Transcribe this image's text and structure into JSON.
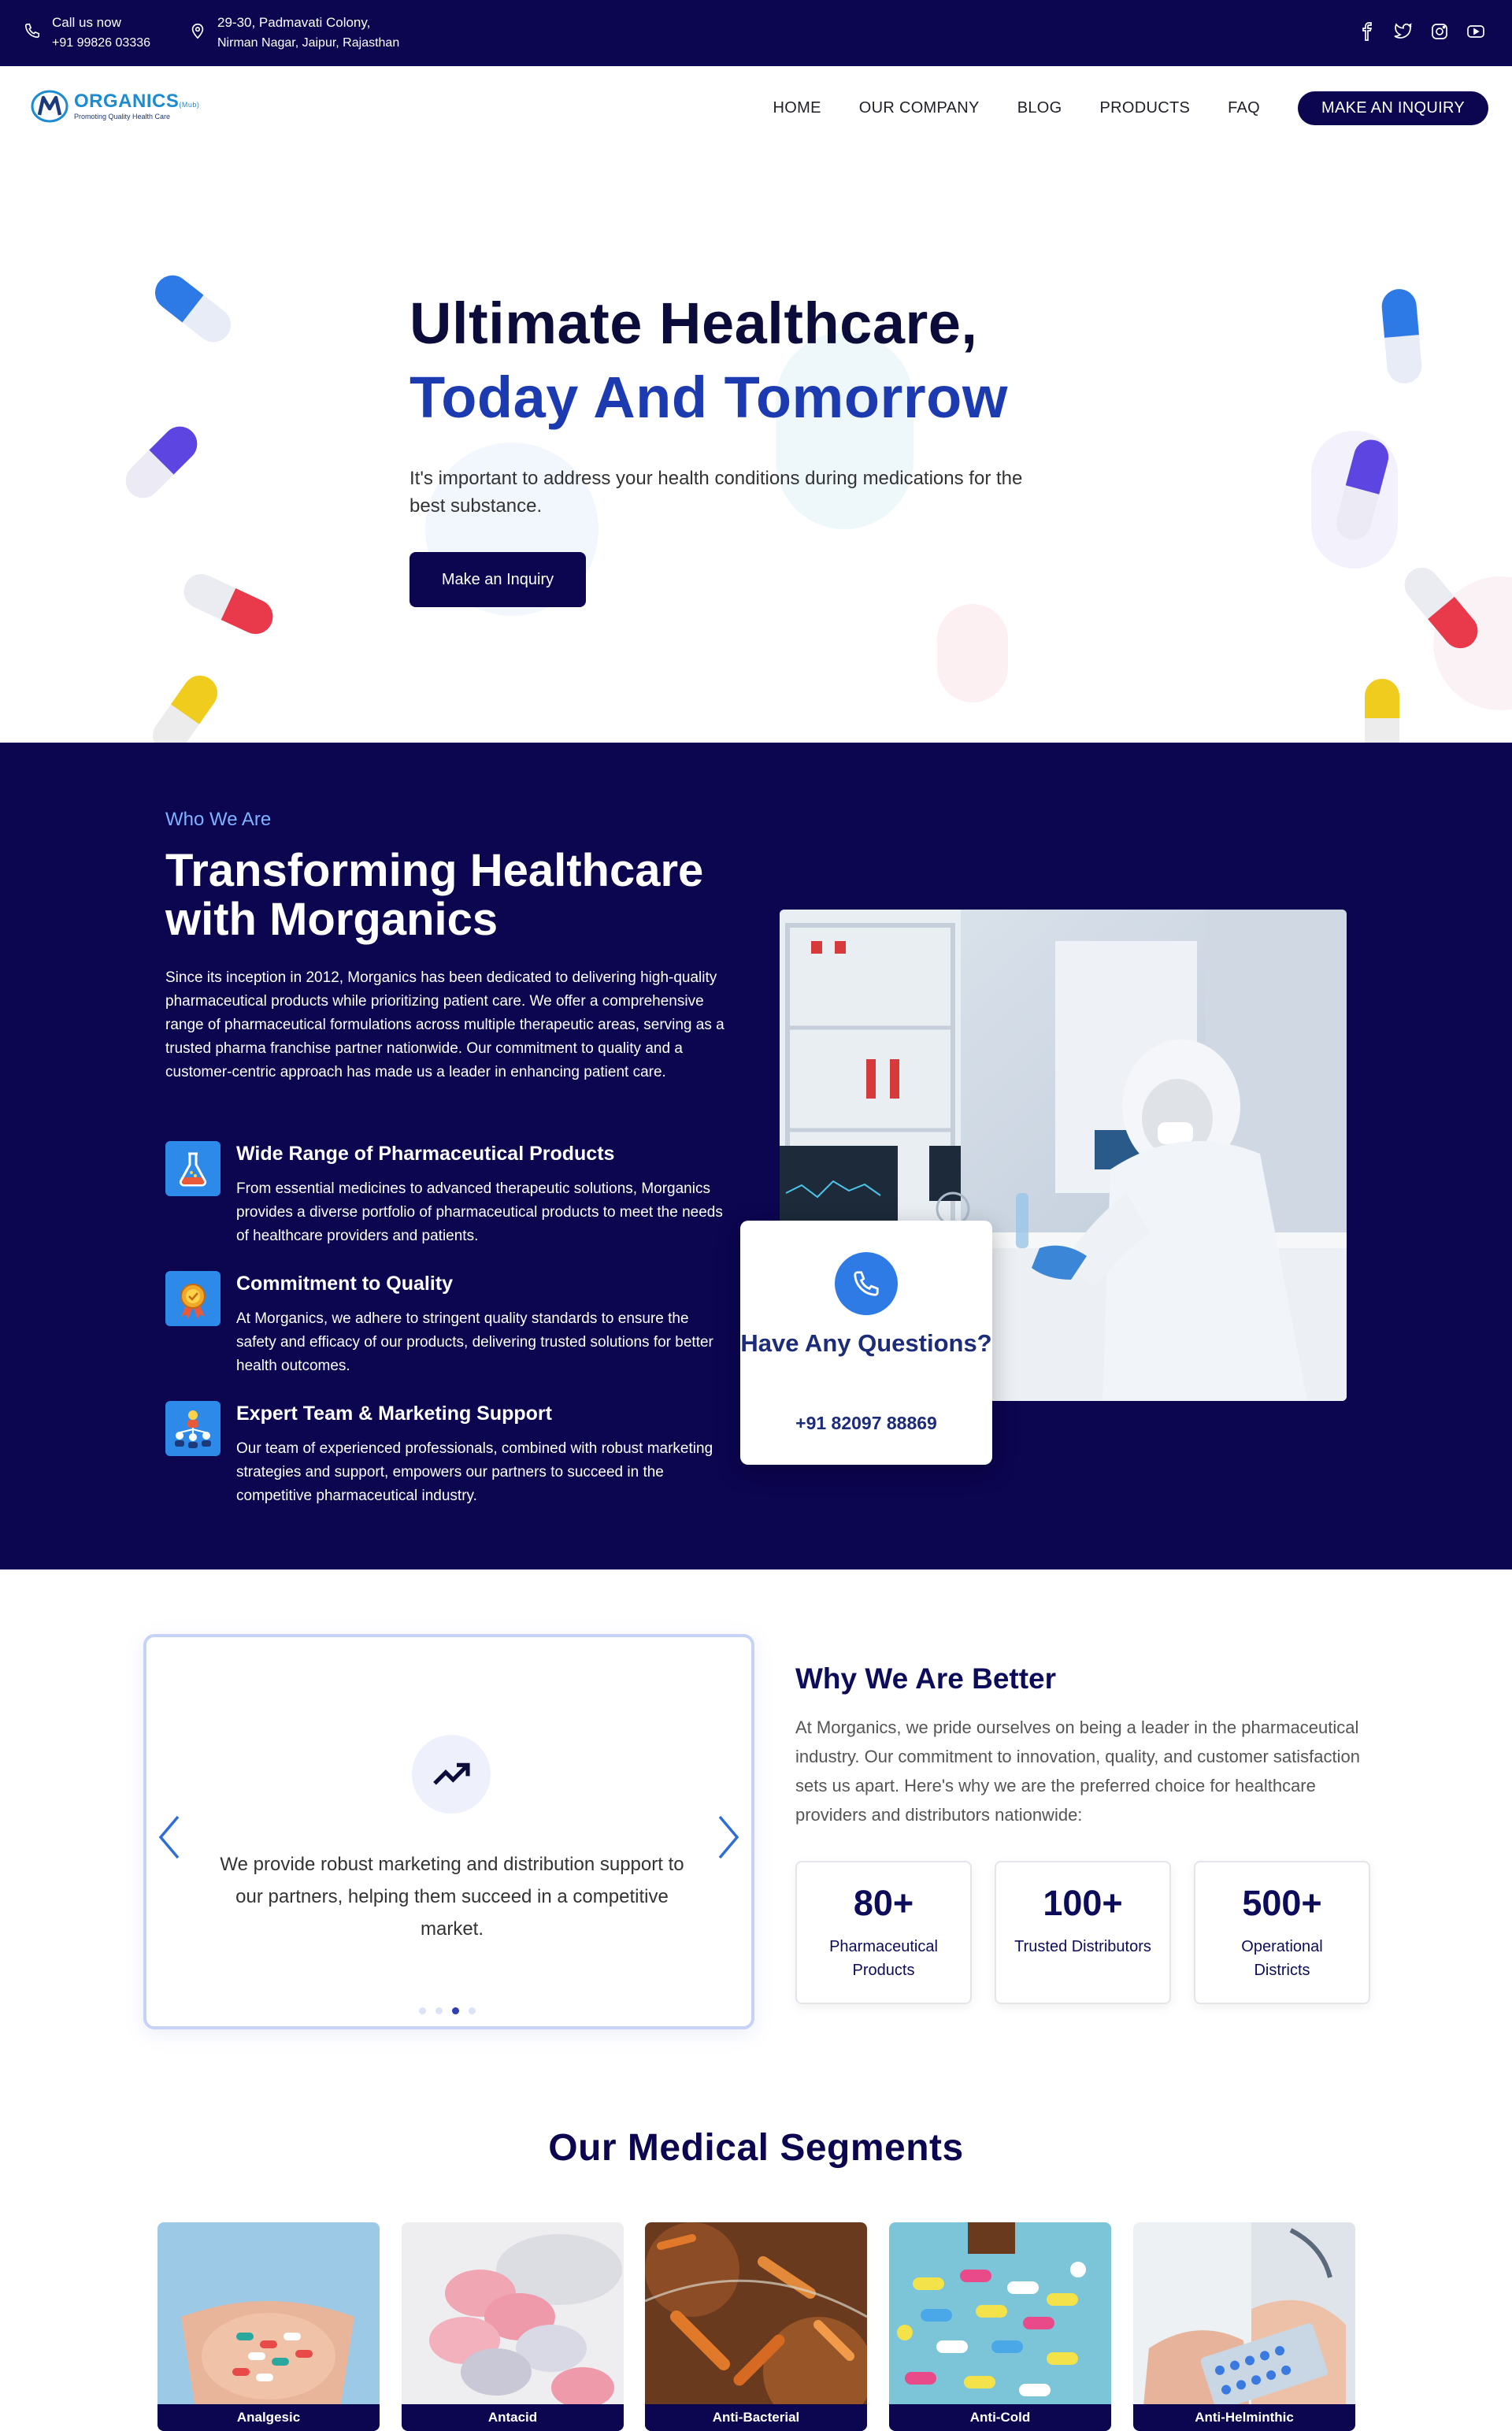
{
  "topbar": {
    "call_label": "Call us now",
    "call_number": "+91 99826 03336",
    "address_line1": "29-30, Padmavati Colony,",
    "address_line2": "Nirman Nagar, Jaipur, Rajasthan",
    "socials": [
      "facebook-icon",
      "twitter-icon",
      "instagram-icon",
      "youtube-icon"
    ]
  },
  "nav": {
    "logo_name": "ORGANICS",
    "logo_suffix": "(Mub)",
    "logo_tagline": "Promoting Quality Health Care",
    "menu": [
      "HOME",
      "OUR COMPANY",
      "BLOG",
      "PRODUCTS",
      "FAQ"
    ],
    "cta": "MAKE AN INQUIRY"
  },
  "hero": {
    "title_line1": "Ultimate Healthcare,",
    "title_line2": "Today And Tomorrow",
    "description": "It's important to address your health conditions during medications for the best substance.",
    "button": "Make an Inquiry"
  },
  "who": {
    "eyebrow": "Who We Are",
    "title": "Transforming Healthcare with Morganics",
    "description": "Since its inception in 2012, Morganics has been dedicated to delivering high-quality pharmaceutical products while prioritizing patient care. We offer a comprehensive range of pharmaceutical formulations across multiple therapeutic areas, serving as a trusted pharma franchise partner nationwide. Our commitment to quality and a customer-centric approach has made us a leader in enhancing patient care.",
    "features": [
      {
        "title": "Wide Range of Pharmaceutical Products",
        "desc": "From essential medicines to advanced therapeutic solutions, Morganics provides a diverse portfolio of pharmaceutical products to meet the needs of healthcare providers and patients."
      },
      {
        "title": "Commitment to Quality",
        "desc": "At Morganics, we adhere to stringent quality standards to ensure the safety and efficacy of our products, delivering trusted solutions for better health outcomes."
      },
      {
        "title": "Expert Team & Marketing Support",
        "desc": "Our team of experienced professionals, combined with robust marketing strategies and support, empowers our partners to succeed in the competitive pharmaceutical industry."
      }
    ],
    "question_card": {
      "title": "Have Any Questions?",
      "phone": "+91 82097 88869"
    }
  },
  "why": {
    "slide_text": "We provide robust marketing and distribution support to our partners, helping them succeed in a competitive market.",
    "slide_count": 4,
    "active_slide": 3,
    "title": "Why We Are Better",
    "description": "At Morganics, we pride ourselves on being a leader in the pharmaceutical industry. Our commitment to innovation, quality, and customer satisfaction sets us apart. Here's why we are the preferred choice for healthcare providers and distributors nationwide:",
    "stats": [
      {
        "number": "80+",
        "label": "Pharmaceutical Products"
      },
      {
        "number": "100+",
        "label": "Trusted Distributors"
      },
      {
        "number": "500+",
        "label": "Operational Districts"
      }
    ]
  },
  "segments": {
    "title": "Our Medical Segments",
    "items": [
      "Analgesic",
      "Antacid",
      "Anti-Bacterial",
      "Anti-Cold",
      "Anti-Helminthic"
    ]
  },
  "colors": {
    "navy": "#0c0550",
    "hero_blue": "#1c3bb0",
    "accent_blue": "#2f7be6"
  }
}
